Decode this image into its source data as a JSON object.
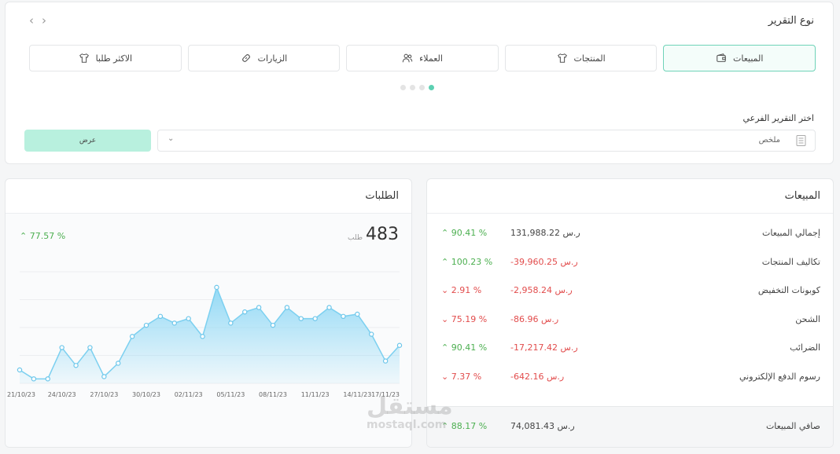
{
  "report": {
    "title": "نوع التقرير",
    "types": [
      {
        "label": "المبيعات",
        "icon": "wallet-icon",
        "active": true
      },
      {
        "label": "المنتجات",
        "icon": "shirt-icon",
        "active": false
      },
      {
        "label": "العملاء",
        "icon": "users-icon",
        "active": false
      },
      {
        "label": "الزيارات",
        "icon": "link-icon",
        "active": false
      },
      {
        "label": "الاكثر طلبا",
        "icon": "shirt-icon",
        "active": false
      }
    ],
    "sub_label": "اختر التقرير الفرعي",
    "sub_value": "ملخص",
    "show_label": "عرض"
  },
  "sales": {
    "title": "المبيعات",
    "rows": [
      {
        "label": "إجمالي المبيعات",
        "value": "131,988.22",
        "currency": "ر.س",
        "pct": "90.41 %",
        "dir": "up",
        "neg": false
      },
      {
        "label": "تكاليف المنتجات",
        "value": "-39,960.25",
        "currency": "ر.س",
        "pct": "100.23 %",
        "dir": "up",
        "neg": true
      },
      {
        "label": "كوبونات التخفيض",
        "value": "-2,958.24",
        "currency": "ر.س",
        "pct": "2.91 %",
        "dir": "down",
        "neg": true
      },
      {
        "label": "الشحن",
        "value": "-86.96",
        "currency": "ر.س",
        "pct": "75.19 %",
        "dir": "down",
        "neg": true
      },
      {
        "label": "الضرائب",
        "value": "-17,217.42",
        "currency": "ر.س",
        "pct": "90.41 %",
        "dir": "up",
        "neg": true
      },
      {
        "label": "رسوم الدفع الإلكتروني",
        "value": "-642.16",
        "currency": "ر.س",
        "pct": "7.37 %",
        "dir": "down",
        "neg": true
      }
    ],
    "net": {
      "label": "صافي المبيعات",
      "value": "74,081.43",
      "currency": "ر.س",
      "pct": "88.17 %",
      "dir": "up"
    }
  },
  "orders": {
    "title": "الطلبات",
    "count": "483",
    "unit": "طلب",
    "pct": "77.57 %"
  },
  "watermark": {
    "line1": "مستقل",
    "line2": "mostaql.com"
  },
  "colors": {
    "accent": "#5dd0b2",
    "positive": "#4caf50",
    "negative": "#e24c4c",
    "area": "#8fd8f5"
  },
  "chart_data": {
    "type": "area",
    "x": [
      "21/10/23",
      "22/10/23",
      "23/10/23",
      "24/10/23",
      "25/10/23",
      "26/10/23",
      "27/10/23",
      "28/10/23",
      "29/10/23",
      "30/10/23",
      "31/10/23",
      "01/11/23",
      "02/11/23",
      "03/11/23",
      "04/11/23",
      "05/11/23",
      "06/11/23",
      "07/11/23",
      "08/11/23",
      "09/11/23",
      "10/11/23",
      "11/11/23",
      "12/11/23",
      "13/11/23",
      "14/11/23",
      "15/11/23",
      "16/11/23",
      "17/11/23"
    ],
    "x_tick_labels": [
      "21/10/23",
      "24/10/23",
      "27/10/23",
      "30/10/23",
      "02/11/23",
      "05/11/23",
      "08/11/23",
      "11/11/23",
      "14/11/23",
      "17/11/23"
    ],
    "values": [
      6,
      2,
      2,
      16,
      8,
      16,
      3,
      9,
      21,
      26,
      30,
      27,
      29,
      21,
      43,
      27,
      32,
      34,
      26,
      34,
      29,
      29,
      34,
      30,
      31,
      22,
      10,
      17
    ],
    "ylim": [
      0,
      50
    ],
    "grid": true,
    "legend": "none"
  }
}
